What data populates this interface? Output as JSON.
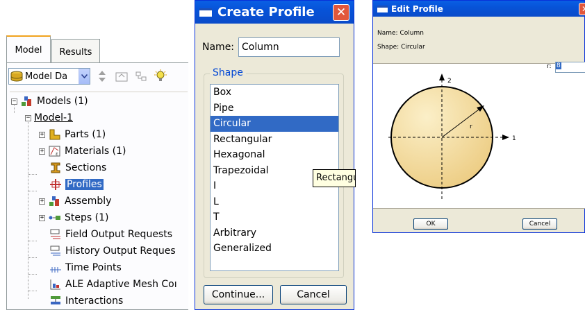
{
  "tree_panel": {
    "tabs": [
      {
        "label": "Model"
      },
      {
        "label": "Results"
      }
    ],
    "toolbar": {
      "combo_value": "Model Da",
      "combo_icon": "database-icon"
    },
    "nodes": {
      "models": "Models (1)",
      "model1": "Model-1",
      "parts": "Parts (1)",
      "materials": "Materials (1)",
      "sections": "Sections",
      "profiles": "Profiles",
      "assembly": "Assembly",
      "steps": "Steps (1)",
      "field_output": "Field Output Requests",
      "history_output": "History Output Reques",
      "time_points": "Time Points",
      "ale": "ALE Adaptive Mesh Coı",
      "interactions": "Interactions"
    }
  },
  "create_profile": {
    "title": "Create Profile",
    "name_label": "Name:",
    "name_value": "Column",
    "shape_legend": "Shape",
    "shapes": [
      "Box",
      "Pipe",
      "Circular",
      "Rectangular",
      "Hexagonal",
      "Trapezoidal",
      "I",
      "L",
      "T",
      "Arbitrary",
      "Generalized"
    ],
    "selected_shape": "Circular",
    "continue_label": "Continue...",
    "cancel_label": "Cancel",
    "tooltip": "Rectangu"
  },
  "edit_profile": {
    "title": "Edit Profile",
    "name_line": "Name: Column",
    "shape_line": "Shape: Circular",
    "r_label": "r:",
    "r_value": "8",
    "axis_1": "1",
    "axis_2": "2",
    "radius_label": "r",
    "ok_label": "OK",
    "cancel_label": "Cancel"
  },
  "colors": {
    "selection": "#316ac5",
    "xp_title": "#0a5fe4",
    "circle_fill": "#f5dca0"
  }
}
